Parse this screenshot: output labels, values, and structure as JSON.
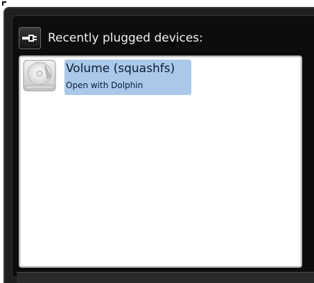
{
  "header": {
    "title": "Recently plugged devices:",
    "icon": "usb-plug-icon"
  },
  "devices": [
    {
      "name": "Volume (squashfs)",
      "action": "Open with Dolphin",
      "icon": "hard-drive-icon",
      "selected": true
    }
  ],
  "colors": {
    "panel_background": "#1f1f1f",
    "header_text": "#f2f2f2",
    "selection_highlight": "#a9c8ea",
    "list_background": "#ffffff"
  }
}
